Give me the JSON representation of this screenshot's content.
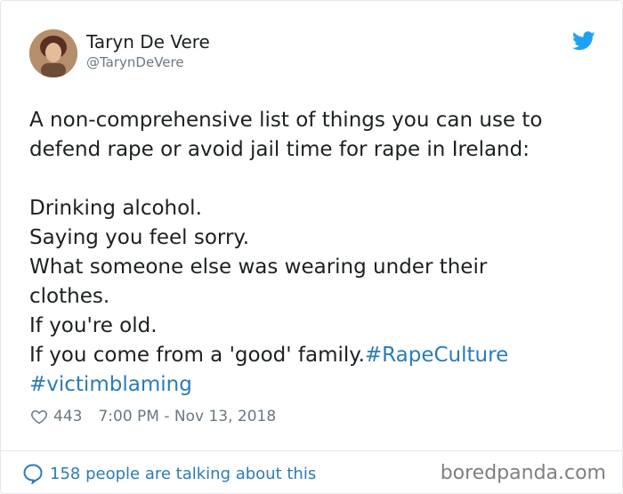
{
  "author": {
    "name": "Taryn De Vere",
    "handle": "@TarynDeVere"
  },
  "tweet": {
    "intro_lines": [
      "A non-comprehensive list of things you can use to",
      "defend rape or avoid jail time for rape in Ireland:"
    ],
    "items": [
      "Drinking alcohol.",
      "Saying you feel sorry.",
      "What someone else was wearing under their",
      "clothes.",
      "If you're old."
    ],
    "last_line_text": "If you come from a 'good' family.",
    "hashtags": [
      "#RapeCulture",
      "#victimblaming"
    ]
  },
  "meta": {
    "likes": "443",
    "timestamp": "7:00 PM - Nov 13, 2018"
  },
  "footer": {
    "talking": "158 people are talking about this",
    "watermark": "boredpanda.com"
  },
  "icons": {
    "bird": "twitter-bird-icon",
    "heart": "heart-outline-icon",
    "bubble": "speech-bubble-icon"
  },
  "colors": {
    "link": "#2b7bb9",
    "text": "#1c2022",
    "secondary": "#697882",
    "twitter_blue": "#1da1f2"
  }
}
